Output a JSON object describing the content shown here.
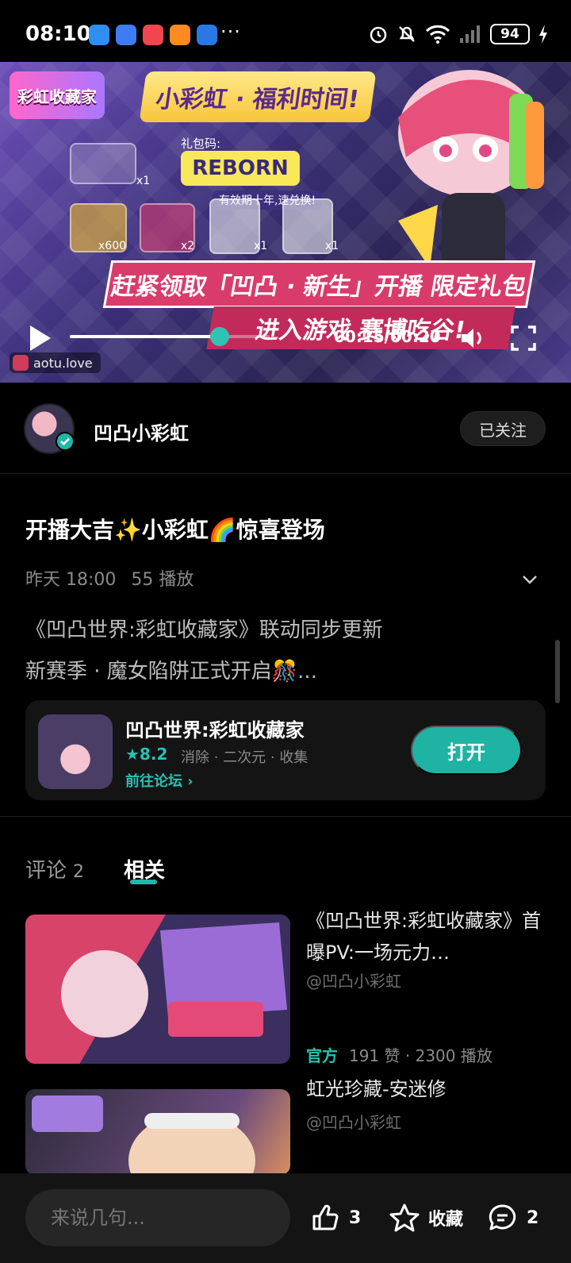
{
  "status_bar": {
    "time": "08:10",
    "more": "···",
    "battery": "94"
  },
  "video": {
    "headline": "小彩虹 · 福利时间!",
    "gift_label": "礼包码:",
    "gift_code": "REBORN",
    "gift_valid": "有效期十年,速兑换!",
    "gift_quantities": [
      "x1",
      "x600",
      "x2",
      "x1",
      "x1"
    ],
    "promo_line1": "赶紧领取「凹凸 · 新生」开播 限定礼包",
    "promo_line2": "进入游戏 赛博吃谷!",
    "current_time": "00:15",
    "duration": "00:20",
    "progress": 0.75,
    "url": "aotu.love"
  },
  "author": {
    "name": "凹凸小彩虹",
    "follow_label": "已关注"
  },
  "post": {
    "title": "开播大吉✨小彩虹🌈惊喜登场",
    "date": "昨天 18:00",
    "plays": "55 播放",
    "desc_line1": "《凹凸世界:彩虹收藏家》联动同步更新",
    "desc_line2": "新赛季 · 魔女陷阱正式开启🎊..."
  },
  "app_card": {
    "name": "凹凸世界:彩虹收藏家",
    "rating": "★8.2",
    "tags": "消除 · 二次元 · 收集",
    "forum_link": "前往论坛 ›",
    "open_label": "打开"
  },
  "tabs": {
    "comments_label": "评论",
    "comments_count": "2",
    "related_label": "相关"
  },
  "related": [
    {
      "title": "《凹凸世界:彩虹收藏家》首曝PV:一场元力…",
      "author": "@凹凸小彩虹",
      "official": "官方",
      "stats": "191 赞 · 2300 播放"
    },
    {
      "title": "虹光珍藏-安迷修",
      "author": "@凹凸小彩虹"
    }
  ],
  "bottom_bar": {
    "comment_placeholder": "来说几句...",
    "like_count": "3",
    "favorite_label": "收藏",
    "comment_count": "2"
  },
  "colors": {
    "accent": "#22b6a8",
    "background": "#000000"
  }
}
